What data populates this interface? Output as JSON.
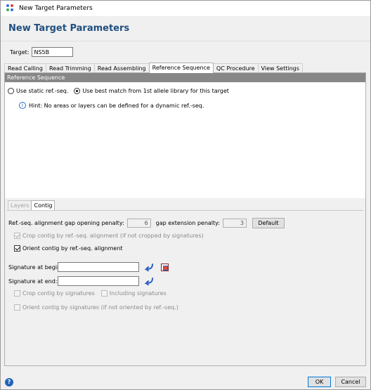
{
  "window": {
    "title": "New Target Parameters"
  },
  "header": {
    "title": "New Target Parameters"
  },
  "target": {
    "label": "Target:",
    "value": "NS5B"
  },
  "tabs": [
    "Read Calling",
    "Read Trimming",
    "Read Assembling",
    "Reference Sequence",
    "QC Procedure",
    "View Settings"
  ],
  "active_tab": "Reference Sequence",
  "reference": {
    "section_title": "Reference Sequence",
    "option_static": "Use static ref.-seq.",
    "option_best_match": "Use best match from 1st allele library for this target",
    "selected": "best_match",
    "hint": "Hint: No areas or layers can be defined for a dynamic ref.-seq."
  },
  "subtabs": [
    "Layers",
    "Contig"
  ],
  "active_subtab": "Contig",
  "contig": {
    "gap_open_label": "Ref.-seq. alignment gap opening penalty:",
    "gap_open_value": "6",
    "gap_ext_label": "gap extension penalty:",
    "gap_ext_value": "3",
    "default_button": "Default",
    "crop_by_alignment": {
      "label": "Crop contig by ref.-seq. alignment (if not cropped by signatures)",
      "checked": true,
      "enabled": false
    },
    "orient_by_alignment": {
      "label": "Orient contig by ref.-seq. alignment",
      "checked": true,
      "enabled": true
    },
    "sig_begin_label": "Signature at begin:",
    "sig_begin_value": "",
    "sig_end_label": "Signature at end:",
    "sig_end_value": "",
    "crop_by_signatures": {
      "label": "Crop contig by signatures",
      "checked": false,
      "enabled": false
    },
    "including_signatures": {
      "label": "Including signatures",
      "checked": false,
      "enabled": false
    },
    "orient_by_signatures": {
      "label": "Orient contig by signatures (if not oriented by ref.-seq.)",
      "checked": false,
      "enabled": false
    }
  },
  "footer": {
    "ok": "OK",
    "cancel": "Cancel"
  },
  "icons": {
    "app": "app-dots-icon",
    "info": "info-icon",
    "arrow": "reverse-arrow-icon",
    "pick": "pick-sequence-icon",
    "help": "help-icon"
  },
  "colors": {
    "header_title": "#1f4f7f",
    "section_bar": "#878787",
    "accent": "#0078d7",
    "help": "#2563b8"
  }
}
